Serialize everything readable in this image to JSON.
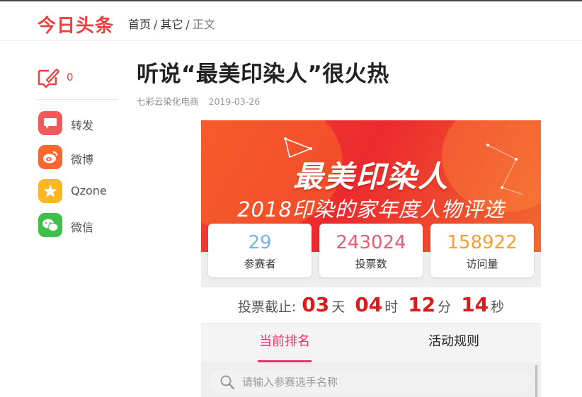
{
  "header": {
    "logo": "今日头条",
    "breadcrumb": {
      "home": "首页",
      "sep1": "/",
      "other": "其它",
      "sep2": "/",
      "current": "正文"
    }
  },
  "sidebar": {
    "comment_count": "0",
    "share": [
      {
        "label": "转发",
        "icon": "repost-icon",
        "color": "#f05a5a"
      },
      {
        "label": "微博",
        "icon": "weibo-icon",
        "color": "#f7672f"
      },
      {
        "label": "Qzone",
        "icon": "qzone-star-icon",
        "color": "#fbb724"
      },
      {
        "label": "微信",
        "icon": "wechat-icon",
        "color": "#3fc04b"
      }
    ]
  },
  "article": {
    "title": "听说“最美印染人”很火热",
    "source": "七彩云染化电商",
    "date": "2019-03-26"
  },
  "poster": {
    "headline": "最美印染人",
    "subheadline": "2018印染的家年度人物评选",
    "stats": [
      {
        "value": "29",
        "label": "参赛者",
        "color": "#6fb6ea"
      },
      {
        "value": "243024",
        "label": "投票数",
        "color": "#ee5a6f"
      },
      {
        "value": "158922",
        "label": "访问量",
        "color": "#f2a02f"
      }
    ],
    "countdown": {
      "label": "投票截止:",
      "days": "03",
      "days_unit": "天",
      "hours": "04",
      "hours_unit": "时",
      "minutes": "12",
      "minutes_unit": "分",
      "seconds": "14",
      "seconds_unit": "秒"
    },
    "tabs": {
      "ranking": "当前排名",
      "rules": "活动规则"
    },
    "search_placeholder": "请输入参赛选手名称"
  }
}
